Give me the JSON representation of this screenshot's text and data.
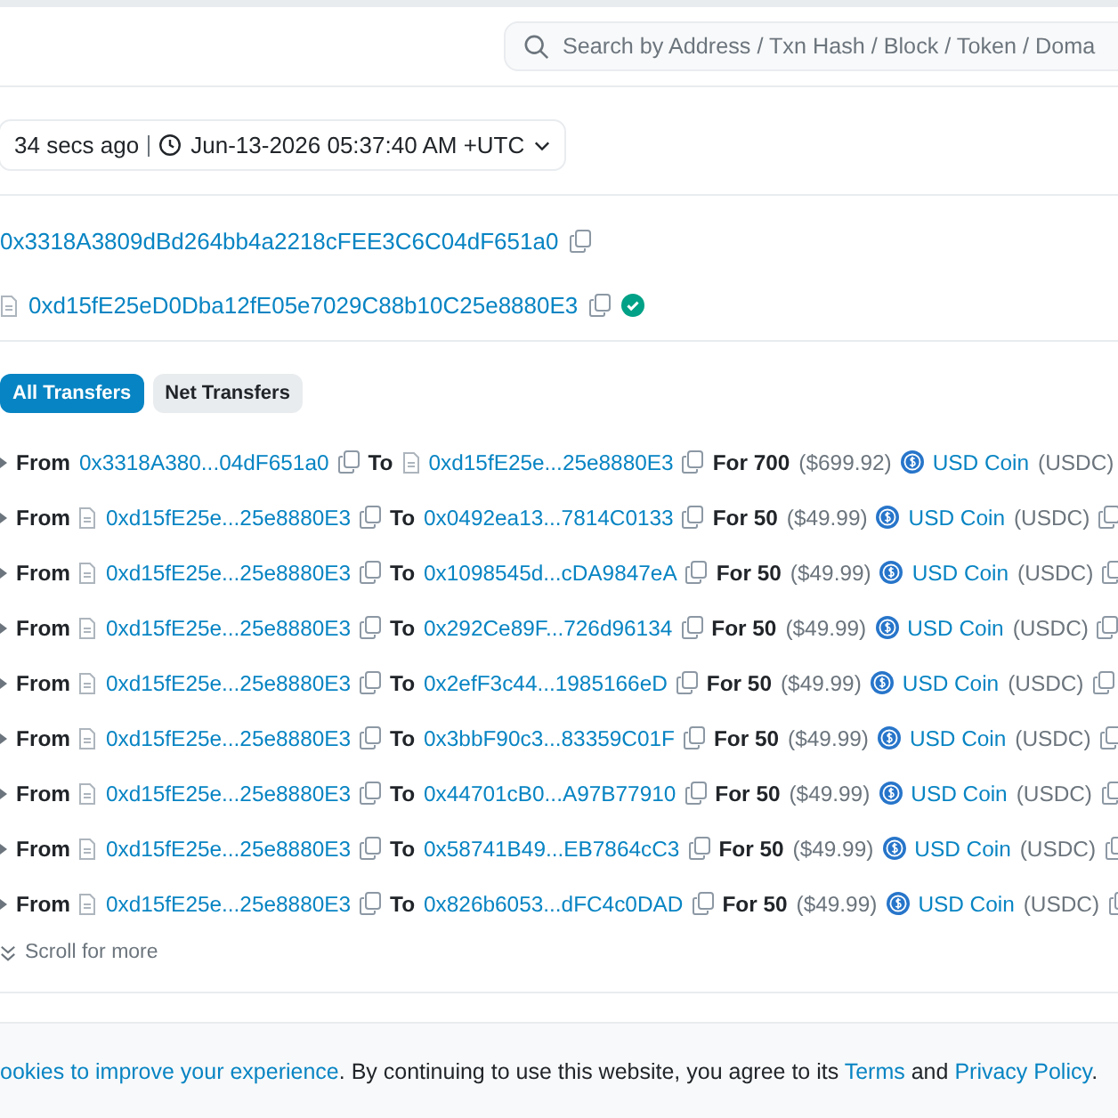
{
  "search": {
    "placeholder": "Search by Address / Txn Hash / Block / Token / Doma"
  },
  "timestamp": {
    "age": "34 secs ago",
    "datetime": "Jun-13-2026 05:37:40 AM +UTC"
  },
  "addresses": [
    {
      "address": "0x3318A3809dBd264bb4a2218cFEE3C6C04dF651a0",
      "contract": false,
      "verified": false
    },
    {
      "address": "0xd15fE25eD0Dba12fE05e7029C88b10C25e8880E3",
      "contract": true,
      "verified": true
    }
  ],
  "tabs": [
    {
      "label": "All Transfers",
      "selected": true
    },
    {
      "label": "Net Transfers",
      "selected": false
    }
  ],
  "transfers": [
    {
      "from_label": "From",
      "from": "0x3318A380...04dF651a0",
      "from_contract": false,
      "to_label": "To",
      "to": "0xd15fE25e...25e8880E3",
      "to_contract": true,
      "amount": "For 700",
      "value": "($699.92)",
      "token": "USD Coin",
      "symbol": "(USDC)"
    },
    {
      "from_label": "From",
      "from": "0xd15fE25e...25e8880E3",
      "from_contract": true,
      "to_label": "To",
      "to": "0x0492ea13...7814C0133",
      "to_contract": false,
      "amount": "For 50",
      "value": "($49.99)",
      "token": "USD Coin",
      "symbol": "(USDC)"
    },
    {
      "from_label": "From",
      "from": "0xd15fE25e...25e8880E3",
      "from_contract": true,
      "to_label": "To",
      "to": "0x1098545d...cDA9847eA",
      "to_contract": false,
      "amount": "For 50",
      "value": "($49.99)",
      "token": "USD Coin",
      "symbol": "(USDC)"
    },
    {
      "from_label": "From",
      "from": "0xd15fE25e...25e8880E3",
      "from_contract": true,
      "to_label": "To",
      "to": "0x292Ce89F...726d96134",
      "to_contract": false,
      "amount": "For 50",
      "value": "($49.99)",
      "token": "USD Coin",
      "symbol": "(USDC)"
    },
    {
      "from_label": "From",
      "from": "0xd15fE25e...25e8880E3",
      "from_contract": true,
      "to_label": "To",
      "to": "0x2efF3c44...1985166eD",
      "to_contract": false,
      "amount": "For 50",
      "value": "($49.99)",
      "token": "USD Coin",
      "symbol": "(USDC)"
    },
    {
      "from_label": "From",
      "from": "0xd15fE25e...25e8880E3",
      "from_contract": true,
      "to_label": "To",
      "to": "0x3bbF90c3...83359C01F",
      "to_contract": false,
      "amount": "For 50",
      "value": "($49.99)",
      "token": "USD Coin",
      "symbol": "(USDC)"
    },
    {
      "from_label": "From",
      "from": "0xd15fE25e...25e8880E3",
      "from_contract": true,
      "to_label": "To",
      "to": "0x44701cB0...A97B77910",
      "to_contract": false,
      "amount": "For 50",
      "value": "($49.99)",
      "token": "USD Coin",
      "symbol": "(USDC)"
    },
    {
      "from_label": "From",
      "from": "0xd15fE25e...25e8880E3",
      "from_contract": true,
      "to_label": "To",
      "to": "0x58741B49...EB7864cC3",
      "to_contract": false,
      "amount": "For 50",
      "value": "($49.99)",
      "token": "USD Coin",
      "symbol": "(USDC)"
    },
    {
      "from_label": "From",
      "from": "0xd15fE25e...25e8880E3",
      "from_contract": true,
      "to_label": "To",
      "to": "0x826b6053...dFC4c0DAD",
      "to_contract": false,
      "amount": "For 50",
      "value": "($49.99)",
      "token": "USD Coin",
      "symbol": "(USDC)"
    }
  ],
  "scroll_hint": "Scroll for more",
  "cookie_notice": {
    "link": "ookies to improve your experience",
    "text": ". By continuing to use this website, you agree to its ",
    "terms": "Terms",
    "joiner": " and ",
    "privacy": "Privacy Policy",
    "end": "."
  }
}
